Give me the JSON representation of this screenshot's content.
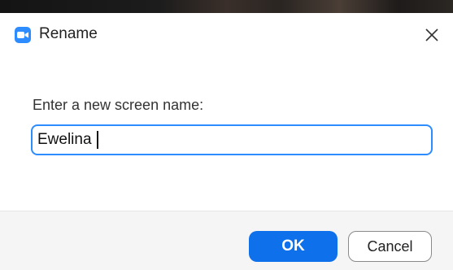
{
  "window": {
    "title": "Rename",
    "app_icon": "zoom-camera-icon",
    "close_icon": "close-icon"
  },
  "form": {
    "prompt": "Enter a new screen name:",
    "name_value": "Ewelina"
  },
  "footer": {
    "ok_label": "OK",
    "cancel_label": "Cancel"
  },
  "colors": {
    "accent": "#0e71eb",
    "input_border": "#2d8cff",
    "footer_bg": "#f5f5f5"
  }
}
